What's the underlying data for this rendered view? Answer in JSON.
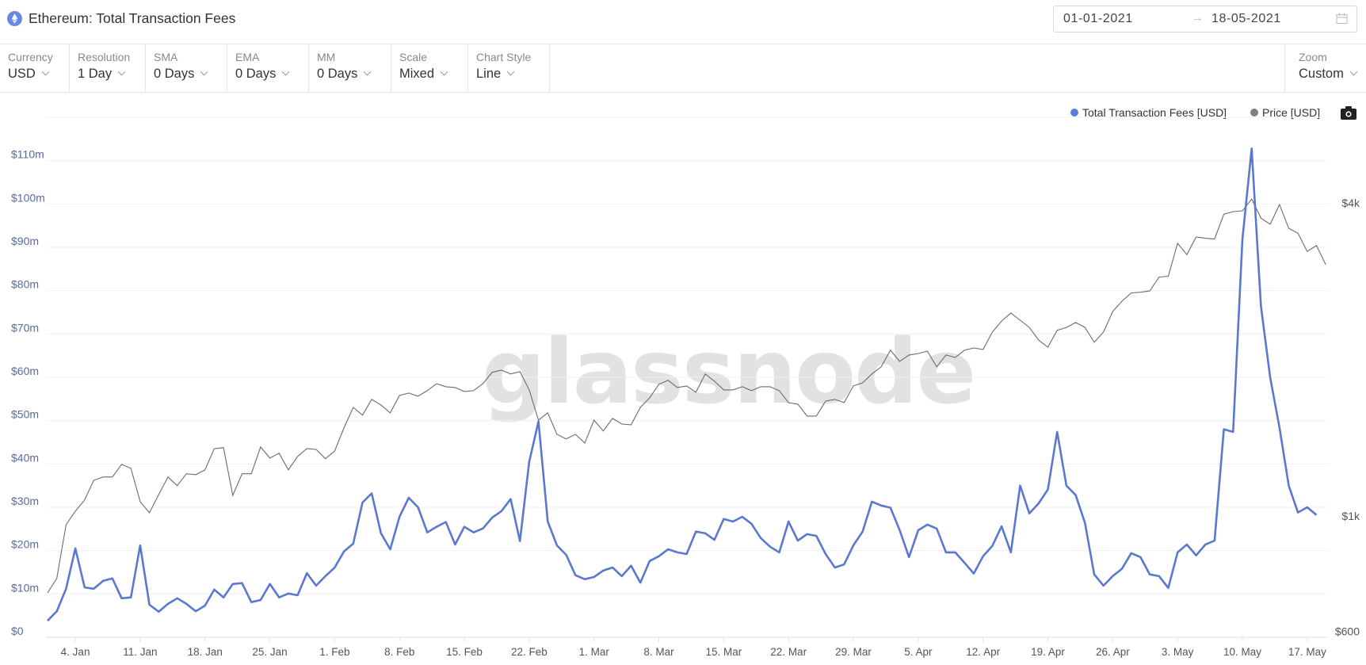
{
  "header": {
    "title": "Ethereum: Total Transaction Fees",
    "icon": "ethereum-icon",
    "date_start": "01-01-2021",
    "date_arrow": "→",
    "date_end": "18-05-2021",
    "calendar_icon": "calendar-icon"
  },
  "toolbar": {
    "items": [
      {
        "label": "Currency",
        "value": "USD"
      },
      {
        "label": "Resolution",
        "value": "1 Day"
      },
      {
        "label": "SMA",
        "value": "0 Days"
      },
      {
        "label": "EMA",
        "value": "0 Days"
      },
      {
        "label": "MM",
        "value": "0 Days"
      },
      {
        "label": "Scale",
        "value": "Mixed"
      },
      {
        "label": "Chart Style",
        "value": "Line"
      }
    ],
    "zoom": {
      "label": "Zoom",
      "value": "Custom"
    }
  },
  "legend": {
    "fees_label": "Total Transaction Fees [USD]",
    "price_label": "Price [USD]",
    "camera_icon": "camera-icon"
  },
  "watermark": "glassnode",
  "colors": {
    "fees": "#5b78d0",
    "price": "#6b6b6b",
    "fees_legend_dot": "#5b7be0",
    "price_legend_dot": "#808080"
  },
  "chart_data": {
    "type": "line",
    "title": "Ethereum: Total Transaction Fees",
    "x_start_date": "2021-01-01",
    "x_unit": "day",
    "x_tick_labels": [
      "4. Jan",
      "11. Jan",
      "18. Jan",
      "25. Jan",
      "1. Feb",
      "8. Feb",
      "15. Feb",
      "22. Feb",
      "1. Mar",
      "8. Mar",
      "15. Mar",
      "22. Mar",
      "29. Mar",
      "5. Apr",
      "12. Apr",
      "19. Apr",
      "26. Apr",
      "3. May",
      "10. May",
      "17. May"
    ],
    "x_tick_days": [
      3,
      10,
      17,
      24,
      31,
      38,
      45,
      52,
      59,
      66,
      73,
      80,
      87,
      94,
      101,
      108,
      115,
      122,
      129,
      136
    ],
    "left_axis": {
      "label": "Total Transaction Fees [USD]",
      "scale": "linear",
      "unit": "millions USD",
      "range": [
        0,
        120
      ],
      "ticks": [
        0,
        10,
        20,
        30,
        40,
        50,
        60,
        70,
        80,
        90,
        100,
        110
      ],
      "tick_labels": [
        "$0",
        "$10m",
        "$20m",
        "$30m",
        "$40m",
        "$50m",
        "$60m",
        "$70m",
        "$80m",
        "$90m",
        "$100m",
        "$110m"
      ]
    },
    "right_axis": {
      "label": "Price [USD]",
      "scale": "log",
      "range": [
        584,
        5845
      ],
      "ticks": [
        600,
        1000,
        4000
      ],
      "tick_labels": [
        "$600",
        "$1k",
        "$4k"
      ]
    },
    "grid": true,
    "legend_position": "top-right",
    "series": [
      {
        "name": "Total Transaction Fees [USD]",
        "axis": "left",
        "unit": "millions USD",
        "values": [
          3.8,
          6.0,
          11.2,
          20.5,
          11.5,
          11.2,
          13.0,
          13.6,
          9.0,
          9.2,
          21.2,
          7.5,
          5.9,
          7.7,
          9.0,
          7.7,
          6.0,
          7.3,
          11.0,
          9.2,
          12.3,
          12.5,
          8.1,
          8.6,
          12.3,
          9.2,
          10.1,
          9.7,
          14.8,
          11.9,
          14.1,
          16.1,
          19.8,
          21.6,
          31.1,
          33.2,
          24.0,
          20.3,
          27.8,
          32.2,
          30.0,
          24.2,
          25.5,
          26.6,
          21.4,
          25.5,
          24.2,
          25.1,
          27.6,
          29.1,
          31.9,
          22.2,
          40.5,
          49.8,
          26.7,
          21.2,
          19.0,
          14.3,
          13.4,
          13.9,
          15.4,
          16.1,
          14.1,
          16.5,
          12.6,
          17.6,
          18.7,
          20.3,
          19.6,
          19.2,
          24.4,
          24.0,
          22.5,
          27.3,
          26.7,
          27.8,
          26.2,
          22.9,
          20.9,
          19.6,
          26.7,
          22.3,
          23.8,
          23.4,
          19.2,
          16.1,
          16.8,
          21.2,
          24.4,
          31.3,
          30.4,
          29.9,
          24.7,
          18.5,
          24.7,
          26.0,
          25.1,
          19.6,
          19.6,
          17.2,
          14.7,
          18.7,
          21.1,
          25.6,
          19.6,
          35.0,
          28.6,
          30.9,
          34.1,
          47.4,
          35.0,
          32.8,
          26.4,
          14.5,
          11.9,
          14.1,
          15.8,
          19.4,
          18.5,
          14.5,
          14.1,
          11.4,
          19.6,
          21.4,
          18.9,
          21.4,
          22.3,
          48.0,
          47.4,
          91.8,
          112.8,
          76.4,
          59.9,
          48.4,
          35.0,
          28.8,
          30.0,
          28.2
        ]
      },
      {
        "name": "Price [USD]",
        "axis": "right",
        "unit": "USD",
        "values": [
          711,
          758,
          962,
          1021,
          1073,
          1171,
          1188,
          1188,
          1256,
          1234,
          1065,
          1014,
          1099,
          1188,
          1143,
          1205,
          1200,
          1226,
          1347,
          1352,
          1095,
          1205,
          1205,
          1357,
          1292,
          1320,
          1226,
          1301,
          1347,
          1342,
          1288,
          1333,
          1476,
          1617,
          1562,
          1675,
          1634,
          1578,
          1704,
          1723,
          1699,
          1741,
          1796,
          1772,
          1766,
          1735,
          1741,
          1796,
          1888,
          1907,
          1875,
          1894,
          1747,
          1528,
          1578,
          1435,
          1406,
          1435,
          1381,
          1528,
          1456,
          1540,
          1502,
          1497,
          1617,
          1687,
          1791,
          1823,
          1766,
          1778,
          1729,
          1875,
          1816,
          1747,
          1747,
          1772,
          1741,
          1772,
          1772,
          1741,
          1651,
          1640,
          1556,
          1556,
          1663,
          1675,
          1651,
          1778,
          1803,
          1875,
          1935,
          2083,
          1982,
          2039,
          2053,
          2074,
          1935,
          2039,
          2017,
          2083,
          2104,
          2090,
          2257,
          2371,
          2456,
          2379,
          2304,
          2179,
          2111,
          2275,
          2304,
          2355,
          2304,
          2157,
          2257,
          2473,
          2588,
          2684,
          2693,
          2708,
          2880,
          2891,
          3345,
          3181,
          3440,
          3420,
          3410,
          3806,
          3849,
          3862,
          4069,
          3741,
          3640,
          3971,
          3574,
          3497,
          3227,
          3312,
          3043
        ]
      }
    ]
  }
}
